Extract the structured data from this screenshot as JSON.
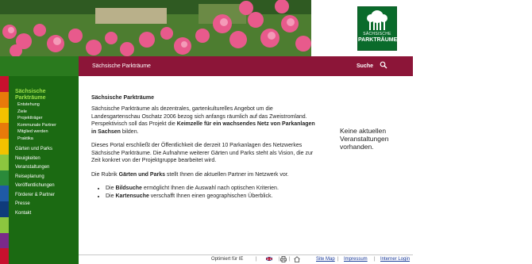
{
  "header": {
    "logo": {
      "line1": "SÄCHSISCHE",
      "line2": "PARKTRÄUME"
    }
  },
  "bar": {
    "title": "Sächsische Parkträume",
    "search_label": "Suche"
  },
  "sidebar": {
    "active": {
      "line1": "Sächsische",
      "line2": "Parkträume"
    },
    "subitems": [
      "Entstehung",
      "Ziele",
      "Projektträger",
      "Kommunale Partner",
      "Mitglied werden",
      "Praktika"
    ],
    "items": [
      "Gärten und Parks",
      "Neuigkeiten",
      "Veranstaltungen",
      "Reiseplanung",
      "Veröffentlichungen",
      "Förderer & Partner",
      "Presse",
      "Kontakt"
    ],
    "stripe_colors": [
      "#c8102e",
      "#e87a0a",
      "#f2c200",
      "#e87a0a",
      "#f2c200",
      "#8cc63f",
      "#2a8a3a",
      "#1f5aa6",
      "#0f3b7a",
      "#8cc63f",
      "#7a2a8a",
      "#c8102e"
    ]
  },
  "main": {
    "heading": "Sächsische Parkträume",
    "p1_a": "Sächsische Parkträume als dezentrales, gartenkulturelles Angebot um die Landesgartenschau Oschatz 2006 bezog sich anfangs räumlich auf das Zweistromland. Perspektivisch soll das Projekt die ",
    "p1_bold": "Keimzelle für ein wachsendes Netz von Parkanlagen in Sachsen",
    "p1_b": " bilden.",
    "p2": "Dieses Portal erschließt der Öffentlichkeit die derzeit 10 Parkanlagen des Netzwerkes Sächsische Parkträume. Die Aufnahme weiterer Gärten und Parks steht als Vision, die zur Zeit konkret von der Projektgruppe bearbeitet wird.",
    "p3_a": "Die Rubrik ",
    "p3_bold": "Gärten und Parks",
    "p3_b": " stellt Ihnen die aktuellen Partner im Netzwerk vor.",
    "li1_a": "Die ",
    "li1_bold": "Bildsuche",
    "li1_b": " ermöglicht Ihnen die Auswahl nach optischen Kriterien.",
    "li2_a": "Die ",
    "li2_bold": "Kartensuche",
    "li2_b": " verschafft Ihnen einen geographischen Überblick."
  },
  "side_note": "Keine aktuellen Veranstaltungen vorhanden.",
  "footer": {
    "optimized": "Optimiert für IE",
    "sep": "|",
    "sitemap": "Site Map",
    "impressum": "Impressum",
    "login": "Interner Login"
  },
  "colors": {
    "bar": "#8c1538",
    "sidebar": "#1b6a12",
    "accent": "#9ce04a"
  }
}
